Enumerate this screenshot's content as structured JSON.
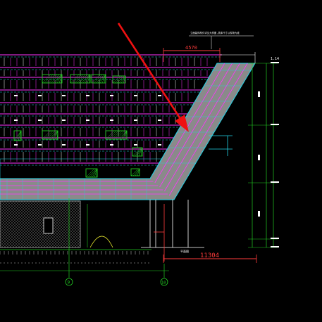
{
  "drawing": {
    "header_note": "立面装饰构件详见大样图,具体尺寸以现场为准",
    "top_dimension": "4570",
    "right_top_dim": "1.14",
    "bottom_dimension": "11304",
    "axis_left": "9",
    "axis_right": "10",
    "right_annotation": "平面图",
    "colors": {
      "background": "#000000",
      "facade_lines": "#ff33ff",
      "green_panels": "#22cc22",
      "slab_gray": "#8a8a8a",
      "cyan": "#22d3e6",
      "yellow": "#ffff33",
      "red_dim": "#ff3b3b",
      "arrow": "#ee1111",
      "white": "#ffffff"
    }
  }
}
